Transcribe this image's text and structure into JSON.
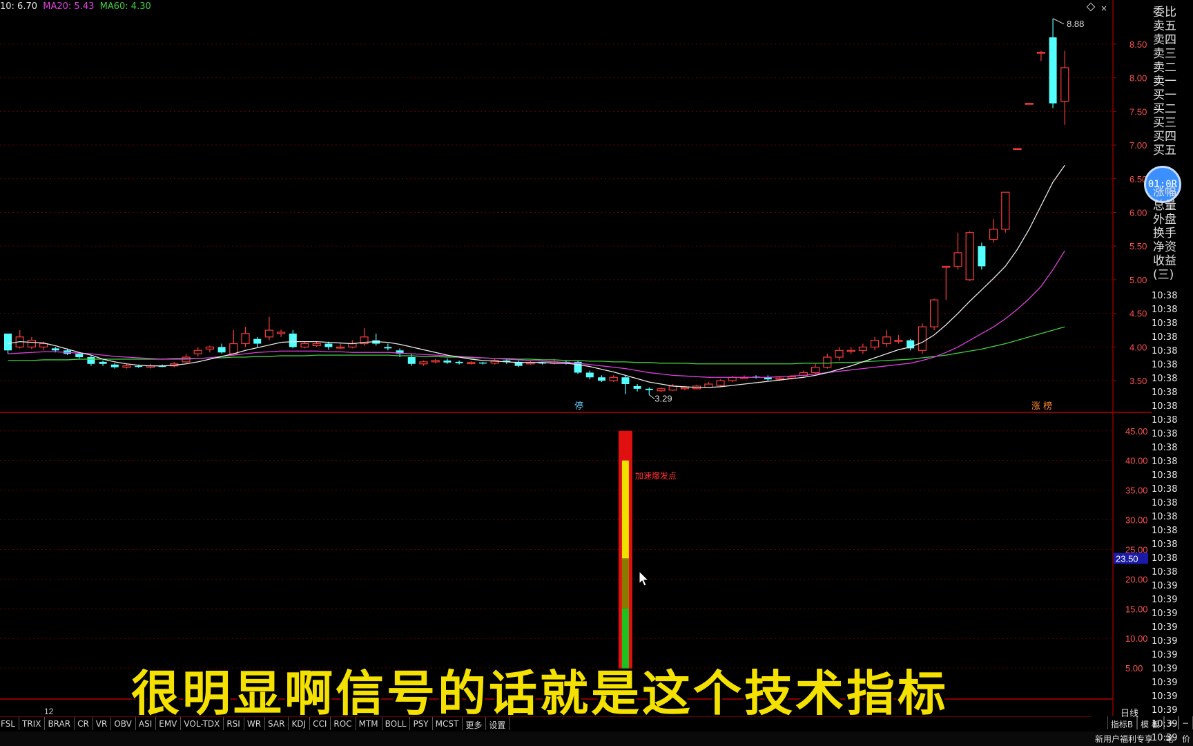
{
  "legend": {
    "ma10": "10: 6.70",
    "ma20": "MA20: 5.43",
    "ma60": "MA60: 4.30"
  },
  "price_axis": {
    "ticks": [
      "8.50",
      "8.00",
      "7.50",
      "7.00",
      "6.50",
      "6.00",
      "5.50",
      "5.00",
      "4.50",
      "4.00",
      "3.50"
    ],
    "min": 3.05,
    "max": 8.95
  },
  "indicator_axis": {
    "ticks": [
      "45.00",
      "40.00",
      "35.00",
      "30.00",
      "25.00",
      "20.00",
      "15.00",
      "10.00",
      "5.00"
    ],
    "highlight_value": "23.50"
  },
  "annotations": {
    "high": "8.88",
    "low": "3.29",
    "ting": "停",
    "zhangbang": "涨 榜",
    "signal_label": "加速爆发点",
    "under_label": "12"
  },
  "side_panel": {
    "labels": [
      "委比",
      "卖五",
      "卖四",
      "卖三",
      "卖二",
      "卖一",
      "买一",
      "买二",
      "买三",
      "买四",
      "买五",
      "",
      "",
      "涨幅",
      "总量",
      "外盘",
      "换手",
      "净资",
      "收益(三)"
    ],
    "clock": "01:0R",
    "times": [
      "10:38",
      "10:38",
      "10:38",
      "10:38",
      "10:38",
      "10:38",
      "10:38",
      "10:38",
      "10:38",
      "10:38",
      "10:38",
      "10:38",
      "10:38",
      "10:38",
      "10:38",
      "10:38",
      "10:38",
      "10:38",
      "10:38",
      "10:38",
      "10:38",
      "10:39",
      "10:39",
      "10:39",
      "10:39",
      "10:39",
      "10:39",
      "10:39",
      "10:39",
      "10:39",
      "10:39",
      "10:39",
      "10:39"
    ]
  },
  "subtitle": "很明显啊信号的话就是这个技术指标",
  "tabs": [
    "FSL",
    "TRIX",
    "BRAR",
    "CR",
    "VR",
    "OBV",
    "ASI",
    "EMV",
    "VOL-TDX",
    "RSI",
    "WR",
    "SAR",
    "KDJ",
    "CCI",
    "ROC",
    "MTM",
    "BOLL",
    "PSY",
    "MCST",
    "更多",
    "设置"
  ],
  "status": {
    "period": "日线",
    "indicator_b": "指标B",
    "template": "模 板",
    "plus": "+",
    "minus": "−",
    "promo": "新用户福利专享",
    "pen": "笔",
    "price": "价"
  },
  "colors": {
    "up": "#ff3b3b",
    "down": "#54ffff",
    "ma10": "#e8e8e8",
    "ma20": "#e040e0",
    "ma60": "#40d040",
    "grid": "#6a0000"
  },
  "chart_data": {
    "type": "candlestick",
    "candles": [
      [
        4.2,
        3.95,
        4.2,
        3.9
      ],
      [
        4.0,
        4.15,
        4.25,
        3.98
      ],
      [
        4.0,
        4.1,
        4.15,
        3.97
      ],
      [
        4.0,
        4.05,
        4.08,
        3.95
      ],
      [
        3.98,
        3.95,
        4.0,
        3.92
      ],
      [
        3.95,
        3.9,
        3.98,
        3.88
      ],
      [
        3.9,
        3.85,
        3.92,
        3.82
      ],
      [
        3.85,
        3.75,
        3.87,
        3.72
      ],
      [
        3.78,
        3.75,
        3.8,
        3.72
      ],
      [
        3.74,
        3.7,
        3.76,
        3.68
      ],
      [
        3.7,
        3.72,
        3.75,
        3.68
      ],
      [
        3.72,
        3.71,
        3.74,
        3.69
      ],
      [
        3.7,
        3.72,
        3.75,
        3.68
      ],
      [
        3.72,
        3.71,
        3.74,
        3.7
      ],
      [
        3.72,
        3.75,
        3.78,
        3.7
      ],
      [
        3.78,
        3.85,
        3.9,
        3.76
      ],
      [
        3.9,
        3.95,
        4.0,
        3.86
      ],
      [
        3.97,
        4.0,
        4.02,
        3.92
      ],
      [
        4.0,
        3.92,
        4.05,
        3.9
      ],
      [
        3.9,
        4.05,
        4.25,
        3.88
      ],
      [
        4.05,
        4.2,
        4.3,
        4.0
      ],
      [
        4.12,
        4.05,
        4.15,
        4.0
      ],
      [
        4.15,
        4.25,
        4.45,
        4.1
      ],
      [
        4.2,
        4.22,
        4.26,
        4.15
      ],
      [
        4.2,
        4.0,
        4.25,
        3.98
      ],
      [
        4.0,
        4.05,
        4.08,
        3.98
      ],
      [
        4.02,
        4.05,
        4.08,
        4.0
      ],
      [
        4.05,
        4.0,
        4.08,
        3.96
      ],
      [
        4.0,
        4.0,
        4.05,
        3.97
      ],
      [
        4.0,
        4.05,
        4.1,
        3.98
      ],
      [
        4.05,
        4.15,
        4.28,
        4.02
      ],
      [
        4.1,
        4.05,
        4.2,
        4.02
      ],
      [
        4.0,
        3.98,
        4.05,
        3.95
      ],
      [
        3.95,
        3.9,
        3.98,
        3.85
      ],
      [
        3.85,
        3.75,
        3.9,
        3.72
      ],
      [
        3.75,
        3.78,
        3.8,
        3.72
      ],
      [
        3.78,
        3.8,
        3.82,
        3.76
      ],
      [
        3.8,
        3.77,
        3.83,
        3.75
      ],
      [
        3.78,
        3.76,
        3.8,
        3.74
      ],
      [
        3.76,
        3.77,
        3.79,
        3.74
      ],
      [
        3.77,
        3.76,
        3.78,
        3.74
      ],
      [
        3.76,
        3.8,
        3.82,
        3.74
      ],
      [
        3.8,
        3.78,
        3.82,
        3.75
      ],
      [
        3.78,
        3.72,
        3.8,
        3.7
      ],
      [
        3.75,
        3.77,
        3.79,
        3.74
      ],
      [
        3.77,
        3.76,
        3.78,
        3.74
      ],
      [
        3.76,
        3.78,
        3.82,
        3.74
      ],
      [
        3.78,
        3.76,
        3.8,
        3.74
      ],
      [
        3.78,
        3.62,
        3.8,
        3.6
      ],
      [
        3.62,
        3.55,
        3.65,
        3.52
      ],
      [
        3.55,
        3.5,
        3.58,
        3.48
      ],
      [
        3.5,
        3.55,
        3.58,
        3.48
      ],
      [
        3.55,
        3.45,
        3.58,
        3.3
      ],
      [
        3.42,
        3.38,
        3.45,
        3.34
      ],
      [
        3.38,
        3.36,
        3.4,
        3.29
      ],
      [
        3.35,
        3.38,
        3.4,
        3.33
      ],
      [
        3.36,
        3.42,
        3.45,
        3.35
      ],
      [
        3.38,
        3.4,
        3.42,
        3.36
      ],
      [
        3.38,
        3.42,
        3.44,
        3.37
      ],
      [
        3.4,
        3.45,
        3.48,
        3.39
      ],
      [
        3.43,
        3.5,
        3.52,
        3.41
      ],
      [
        3.5,
        3.55,
        3.57,
        3.48
      ],
      [
        3.55,
        3.55,
        3.58,
        3.53
      ],
      [
        3.56,
        3.55,
        3.58,
        3.53
      ],
      [
        3.55,
        3.52,
        3.58,
        3.5
      ],
      [
        3.52,
        3.54,
        3.56,
        3.5
      ],
      [
        3.54,
        3.56,
        3.58,
        3.52
      ],
      [
        3.58,
        3.62,
        3.65,
        3.56
      ],
      [
        3.62,
        3.7,
        3.75,
        3.6
      ],
      [
        3.7,
        3.85,
        3.9,
        3.68
      ],
      [
        3.85,
        3.95,
        4.0,
        3.8
      ],
      [
        3.95,
        3.95,
        4.0,
        3.9
      ],
      [
        3.95,
        4.0,
        4.05,
        3.9
      ],
      [
        4.0,
        4.1,
        4.15,
        3.95
      ],
      [
        4.05,
        4.15,
        4.25,
        4.0
      ],
      [
        4.1,
        4.1,
        4.18,
        4.05
      ],
      [
        4.1,
        3.98,
        4.12,
        3.95
      ],
      [
        3.95,
        4.3,
        4.35,
        3.9
      ],
      [
        4.3,
        4.7,
        4.72,
        4.25
      ],
      [
        5.2,
        5.2,
        5.2,
        4.7
      ],
      [
        5.2,
        5.4,
        5.7,
        5.15
      ],
      [
        5.0,
        5.7,
        5.72,
        4.98
      ],
      [
        5.5,
        5.2,
        5.55,
        5.15
      ],
      [
        5.6,
        5.75,
        5.9,
        5.55
      ],
      [
        5.75,
        6.3,
        6.3,
        5.7
      ],
      [
        6.95,
        6.95,
        6.95,
        6.95
      ],
      [
        7.62,
        7.62,
        7.62,
        7.62
      ],
      [
        8.38,
        8.38,
        8.4,
        8.25
      ],
      [
        8.6,
        7.62,
        8.88,
        7.55
      ],
      [
        7.65,
        8.15,
        8.4,
        7.3
      ]
    ],
    "ma10": [
      4.05,
      4.08,
      4.07,
      4.06,
      4.02,
      3.97,
      3.92,
      3.88,
      3.82,
      3.78,
      3.75,
      3.73,
      3.72,
      3.72,
      3.73,
      3.75,
      3.78,
      3.82,
      3.86,
      3.9,
      3.95,
      3.99,
      4.03,
      4.07,
      4.08,
      4.08,
      4.08,
      4.07,
      4.06,
      4.05,
      4.07,
      4.08,
      4.07,
      4.04,
      4.0,
      3.96,
      3.92,
      3.88,
      3.85,
      3.82,
      3.8,
      3.79,
      3.78,
      3.77,
      3.77,
      3.77,
      3.76,
      3.76,
      3.74,
      3.71,
      3.67,
      3.63,
      3.58,
      3.53,
      3.48,
      3.45,
      3.42,
      3.41,
      3.4,
      3.4,
      3.41,
      3.43,
      3.45,
      3.47,
      3.49,
      3.51,
      3.53,
      3.55,
      3.58,
      3.62,
      3.67,
      3.72,
      3.78,
      3.84,
      3.9,
      3.96,
      4.0,
      4.07,
      4.18,
      4.33,
      4.5,
      4.68,
      4.85,
      5.02,
      5.2,
      5.45,
      5.75,
      6.1,
      6.45,
      6.7
    ],
    "ma20": [
      3.9,
      3.91,
      3.92,
      3.93,
      3.93,
      3.92,
      3.91,
      3.9,
      3.88,
      3.86,
      3.85,
      3.84,
      3.83,
      3.82,
      3.82,
      3.82,
      3.83,
      3.84,
      3.86,
      3.88,
      3.9,
      3.92,
      3.93,
      3.94,
      3.94,
      3.94,
      3.94,
      3.93,
      3.93,
      3.92,
      3.92,
      3.92,
      3.92,
      3.91,
      3.9,
      3.89,
      3.88,
      3.87,
      3.86,
      3.85,
      3.84,
      3.83,
      3.82,
      3.81,
      3.8,
      3.79,
      3.78,
      3.77,
      3.76,
      3.74,
      3.72,
      3.7,
      3.68,
      3.65,
      3.62,
      3.6,
      3.58,
      3.57,
      3.56,
      3.55,
      3.55,
      3.55,
      3.55,
      3.55,
      3.55,
      3.56,
      3.57,
      3.58,
      3.6,
      3.62,
      3.64,
      3.66,
      3.68,
      3.7,
      3.72,
      3.74,
      3.76,
      3.8,
      3.85,
      3.92,
      4.0,
      4.1,
      4.2,
      4.3,
      4.42,
      4.56,
      4.72,
      4.9,
      5.15,
      5.43
    ],
    "ma60": [
      3.8,
      3.8,
      3.8,
      3.81,
      3.81,
      3.81,
      3.82,
      3.82,
      3.82,
      3.82,
      3.82,
      3.82,
      3.82,
      3.82,
      3.83,
      3.83,
      3.83,
      3.84,
      3.84,
      3.85,
      3.85,
      3.86,
      3.86,
      3.87,
      3.87,
      3.87,
      3.88,
      3.88,
      3.88,
      3.88,
      3.88,
      3.88,
      3.88,
      3.87,
      3.87,
      3.86,
      3.86,
      3.85,
      3.85,
      3.84,
      3.84,
      3.83,
      3.83,
      3.82,
      3.82,
      3.81,
      3.81,
      3.8,
      3.8,
      3.79,
      3.79,
      3.78,
      3.78,
      3.77,
      3.77,
      3.76,
      3.76,
      3.76,
      3.75,
      3.75,
      3.75,
      3.75,
      3.75,
      3.75,
      3.75,
      3.75,
      3.75,
      3.76,
      3.76,
      3.76,
      3.77,
      3.77,
      3.78,
      3.79,
      3.8,
      3.81,
      3.82,
      3.84,
      3.86,
      3.88,
      3.91,
      3.94,
      3.97,
      4.01,
      4.05,
      4.1,
      4.15,
      4.2,
      4.25,
      4.3
    ],
    "indicator_bar": {
      "index": 52,
      "outer": 45.0,
      "yellow": 40.0,
      "olive": 23.5,
      "green": 15.0,
      "ylim": [
        0,
        48
      ]
    }
  }
}
